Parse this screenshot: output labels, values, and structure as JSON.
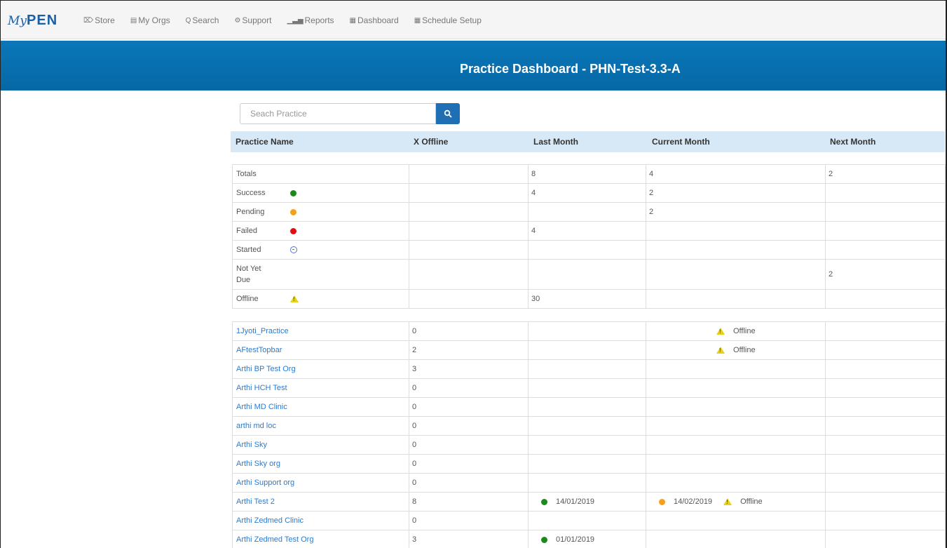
{
  "brand": {
    "my": "My",
    "pen": "PEN"
  },
  "nav": [
    {
      "icon": "cart-icon",
      "glyph": "⌦",
      "label": "Store"
    },
    {
      "icon": "document-icon",
      "glyph": "▤",
      "label": "My Orgs"
    },
    {
      "icon": "search-icon",
      "glyph": "Q",
      "label": "Search"
    },
    {
      "icon": "gear-icon",
      "glyph": "⚙",
      "label": "Support"
    },
    {
      "icon": "bar-chart-icon",
      "glyph": "▁▃▅",
      "label": "Reports"
    },
    {
      "icon": "dashboard-icon",
      "glyph": "▦",
      "label": "Dashboard"
    },
    {
      "icon": "dashboard-icon",
      "glyph": "▦",
      "label": "Schedule Setup"
    }
  ],
  "page": {
    "title": "Practice Dashboard - PHN-Test-3.3-A"
  },
  "search": {
    "placeholder": "Seach Practice"
  },
  "columns": [
    "Practice Name",
    "X Offline",
    "Last Month",
    "Current Month",
    "Next Month"
  ],
  "summary": [
    {
      "label": "Totals",
      "icon": "",
      "offline": "",
      "last": "8",
      "current": "4",
      "next": "2"
    },
    {
      "label": "Success",
      "icon": "green-dot",
      "offline": "",
      "last": "4",
      "current": "2",
      "next": ""
    },
    {
      "label": "Pending",
      "icon": "orange-dot",
      "offline": "",
      "last": "",
      "current": "2",
      "next": ""
    },
    {
      "label": "Failed",
      "icon": "red-dot",
      "offline": "",
      "last": "4",
      "current": "",
      "next": ""
    },
    {
      "label": "Started",
      "icon": "started-icon",
      "offline": "",
      "last": "",
      "current": "",
      "next": ""
    },
    {
      "label": "Not Yet\nDue",
      "icon": "",
      "offline": "",
      "last": "",
      "current": "",
      "next": "2"
    },
    {
      "label": "Offline",
      "icon": "warning-icon",
      "offline": "",
      "last": "30",
      "current": "",
      "next": ""
    }
  ],
  "practices": [
    {
      "name": "1Jyoti_Practice",
      "offline": "0",
      "last": null,
      "current": {
        "status": null,
        "date": "",
        "offline_label": "Offline"
      },
      "next": ""
    },
    {
      "name": "AFtestTopbar",
      "offline": "2",
      "last": null,
      "current": {
        "status": null,
        "date": "",
        "offline_label": "Offline"
      },
      "next": ""
    },
    {
      "name": "Arthi BP Test Org",
      "offline": "3",
      "last": null,
      "current": null,
      "next": ""
    },
    {
      "name": "Arthi HCH Test",
      "offline": "0",
      "last": null,
      "current": null,
      "next": ""
    },
    {
      "name": "Arthi MD Clinic",
      "offline": "0",
      "last": null,
      "current": null,
      "next": ""
    },
    {
      "name": "arthi md loc",
      "offline": "0",
      "last": null,
      "current": null,
      "next": ""
    },
    {
      "name": "Arthi Sky",
      "offline": "0",
      "last": null,
      "current": null,
      "next": ""
    },
    {
      "name": "Arthi Sky org",
      "offline": "0",
      "last": null,
      "current": null,
      "next": ""
    },
    {
      "name": "Arthi Support org",
      "offline": "0",
      "last": null,
      "current": null,
      "next": ""
    },
    {
      "name": "Arthi Test 2",
      "offline": "8",
      "last": {
        "status": "success",
        "date": "14/01/2019"
      },
      "current": {
        "status": "pending",
        "date": "14/02/2019",
        "offline_label": "Offline"
      },
      "next": ""
    },
    {
      "name": "Arthi Zedmed Clinic",
      "offline": "0",
      "last": null,
      "current": null,
      "next": ""
    },
    {
      "name": "Arthi Zedmed Test Org",
      "offline": "3",
      "last": {
        "status": "success",
        "date": "01/01/2019"
      },
      "current": null,
      "next": ""
    }
  ],
  "colors": {
    "success": "#1a8a1a",
    "pending": "#f5a01a",
    "failed": "#e01010",
    "started": "#5870d8",
    "warning": "#e6d21a",
    "link": "#2a7bd0",
    "band": "#0a77b8"
  }
}
